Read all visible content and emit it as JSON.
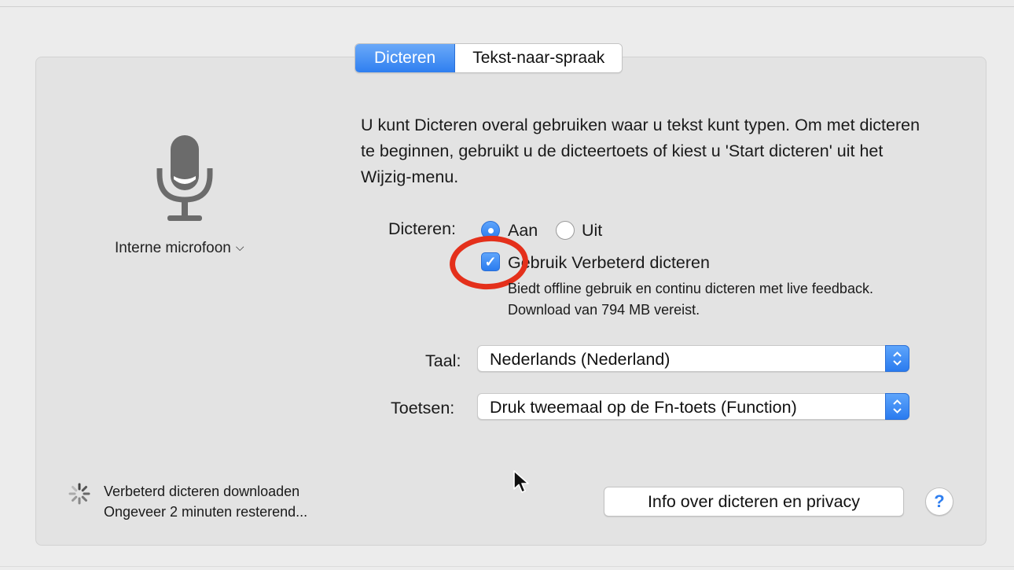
{
  "tabs": [
    {
      "label": "Dicteren",
      "active": true
    },
    {
      "label": "Tekst-naar-spraak",
      "active": false
    }
  ],
  "microphone": {
    "icon": "microphone-icon",
    "selected": "Interne microfoon",
    "dropdown_icon": "chevron-down-icon"
  },
  "description": "U kunt Dicteren overal gebruiken waar u tekst kunt typen. Om met dicteren te beginnen, gebruikt u de dicteertoets of kiest u 'Start dicteren' uit het Wijzig-menu.",
  "dictation": {
    "label": "Dicteren:",
    "options": [
      {
        "label": "Aan",
        "selected": true
      },
      {
        "label": "Uit",
        "selected": false
      }
    ]
  },
  "enhanced": {
    "checked": true,
    "label": "Gebruik Verbeterd dicteren",
    "note": "Biedt offline gebruik en continu dicteren met live feedback. Download van 794 MB vereist."
  },
  "language": {
    "label": "Taal:",
    "value": "Nederlands (Nederland)"
  },
  "shortcut": {
    "label": "Toetsen:",
    "value": "Druk tweemaal op de Fn-toets (Function)"
  },
  "status": {
    "line1": "Verbeterd dicteren downloaden",
    "line2": "Ongeveer 2 minuten resterend..."
  },
  "privacy_button": "Info over dicteren en privacy",
  "help_button": "?",
  "colors": {
    "accent": "#2f7ff0",
    "highlight": "#e4301b"
  }
}
